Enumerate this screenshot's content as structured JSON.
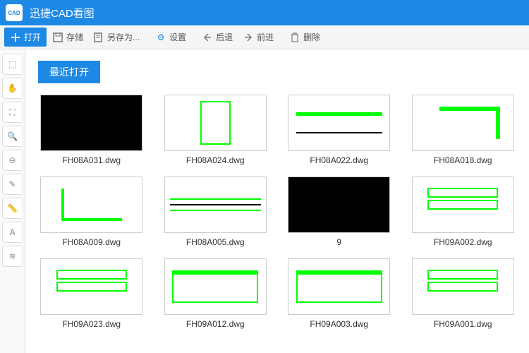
{
  "titlebar": {
    "logo_text": "CAD",
    "app_name": "迅捷CAD看图"
  },
  "toolbar": {
    "open": "打开",
    "save": "存储",
    "save_as": "另存为...",
    "settings": "设置",
    "back": "后退",
    "forward": "前进",
    "delete": "删除"
  },
  "sidebar_tools": [
    {
      "name": "select-icon",
      "glyph": "⬚"
    },
    {
      "name": "pan-icon",
      "glyph": "✋"
    },
    {
      "name": "window-icon",
      "glyph": "⛶"
    },
    {
      "name": "zoom-in-icon",
      "glyph": "🔍"
    },
    {
      "name": "zoom-out-icon",
      "glyph": "⊖"
    },
    {
      "name": "edit-icon",
      "glyph": "✎"
    },
    {
      "name": "measure-icon",
      "glyph": "📏"
    },
    {
      "name": "text-icon",
      "glyph": "A"
    },
    {
      "name": "layers-icon",
      "glyph": "≋"
    }
  ],
  "section": {
    "recent_title": "最近打开"
  },
  "files": [
    {
      "label": "FH08A031.dwg",
      "style": "dark"
    },
    {
      "label": "FH08A024.dwg",
      "style": "col"
    },
    {
      "label": "FH08A022.dwg",
      "style": "molding"
    },
    {
      "label": "FH08A018.dwg",
      "style": "corner"
    },
    {
      "label": "FH08A009.dwg",
      "style": "profile"
    },
    {
      "label": "FH08A005.dwg",
      "style": "hstripe"
    },
    {
      "label": "9",
      "style": "dark"
    },
    {
      "label": "FH09A002.dwg",
      "style": "pedestal"
    },
    {
      "label": "FH09A023.dwg",
      "style": "pedestal"
    },
    {
      "label": "FH09A012.dwg",
      "style": "table"
    },
    {
      "label": "FH09A003.dwg",
      "style": "table"
    },
    {
      "label": "FH09A001.dwg",
      "style": "pedestal"
    }
  ]
}
